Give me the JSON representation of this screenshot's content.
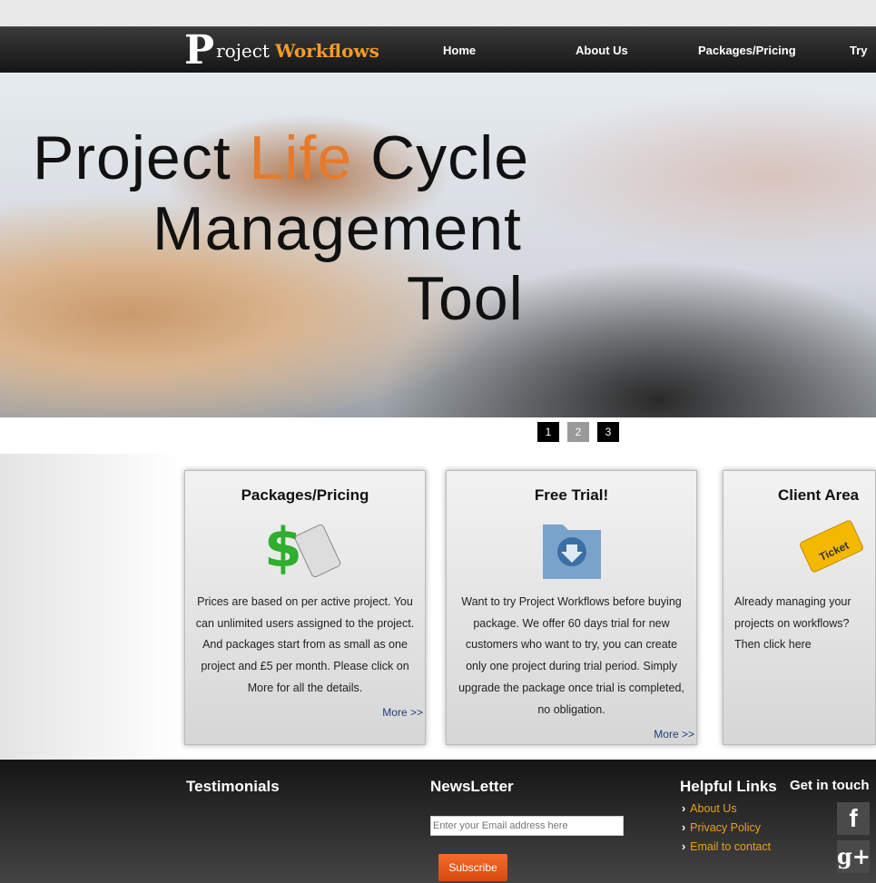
{
  "logo": {
    "p": "P",
    "text1": "roject",
    "text2": "Workflows"
  },
  "nav": [
    "Home",
    "About Us",
    "Packages/Pricing",
    "Try"
  ],
  "hero": {
    "line1a": "Project ",
    "line1b": "Life",
    "line1c": " Cycle",
    "line2": "Management",
    "line3": "Tool"
  },
  "slider": [
    "1",
    "2",
    "3"
  ],
  "cards": [
    {
      "title": "Packages/Pricing",
      "text": "Prices are based on per active project. You can unlimited users assigned to the project. And packages start from as small as one project and £5 per month. Please click on More for all the details.",
      "more": "More >>"
    },
    {
      "title": "Free Trial!",
      "text": "Want to try Project Workflows before buying package. We offer 60 days trial for new customers who want to try, you can create only one project during trial period. Simply upgrade the package once trial is completed, no obligation.",
      "more": "More >>"
    },
    {
      "title": "Client Area",
      "text": "Already managing your projects on workflows? Then click here",
      "ticket": "Ticket"
    }
  ],
  "footer": {
    "testimonials": "Testimonials",
    "newsletter": "NewsLetter",
    "email_placeholder": "Enter your Email address here",
    "subscribe": "Subscribe",
    "helpful": "Helpful Links",
    "links": [
      "About Us",
      "Privacy Policy",
      "Email to contact"
    ],
    "getin": "Get in touch",
    "facebook": "f",
    "gplus": "g+"
  }
}
